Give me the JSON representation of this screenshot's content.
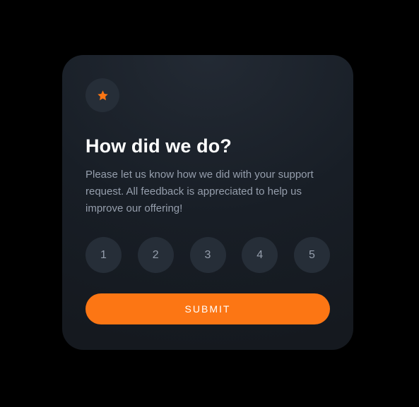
{
  "card": {
    "icon": "star-icon",
    "title": "How did we do?",
    "description": "Please let us know how we did with your support request. All feedback is appreciated to help us improve our offering!",
    "ratings": [
      "1",
      "2",
      "3",
      "4",
      "5"
    ],
    "submit_label": "SUBMIT"
  },
  "colors": {
    "accent": "#fc7614",
    "card_background": "#1e252e",
    "chip_background": "#262e38",
    "text_muted": "#959eac",
    "title": "#ffffff"
  }
}
